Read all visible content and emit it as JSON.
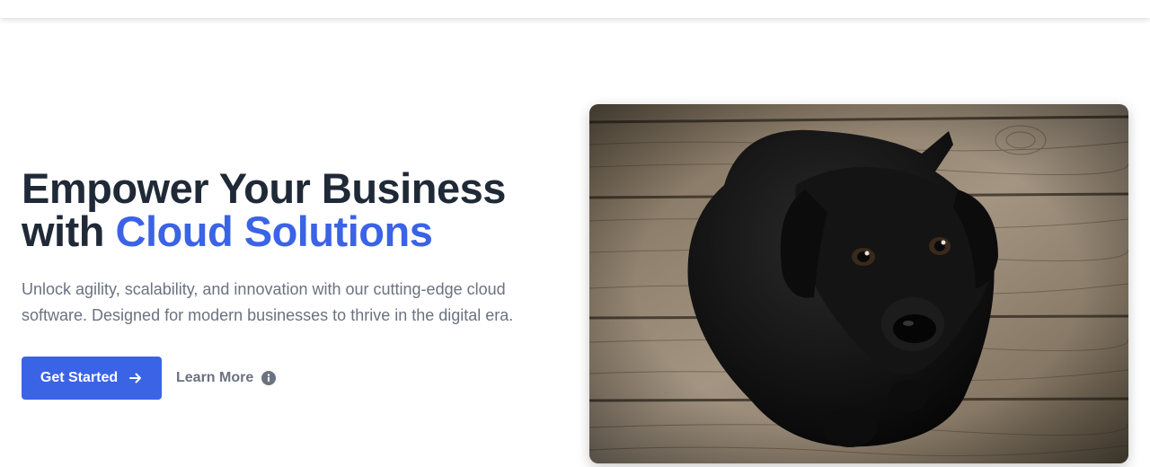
{
  "hero": {
    "headline_line1": "Empower Your Business",
    "headline_with": "with",
    "headline_accent": "Cloud Solutions",
    "subtext": "Unlock agility, scalability, and innovation with our cutting-edge cloud software. Designed for modern businesses to thrive in the digital era.",
    "primary_button": "Get Started",
    "secondary_button": "Learn More",
    "icons": {
      "primary": "arrow-right-icon",
      "secondary": "info-icon"
    },
    "image": {
      "subject": "black-puppy-on-wooden-floor-photo"
    }
  },
  "colors": {
    "heading": "#1f2937",
    "accent": "#3b63e6",
    "body_text": "#6b7280",
    "button_bg": "#3b63e6",
    "button_text": "#ffffff"
  }
}
